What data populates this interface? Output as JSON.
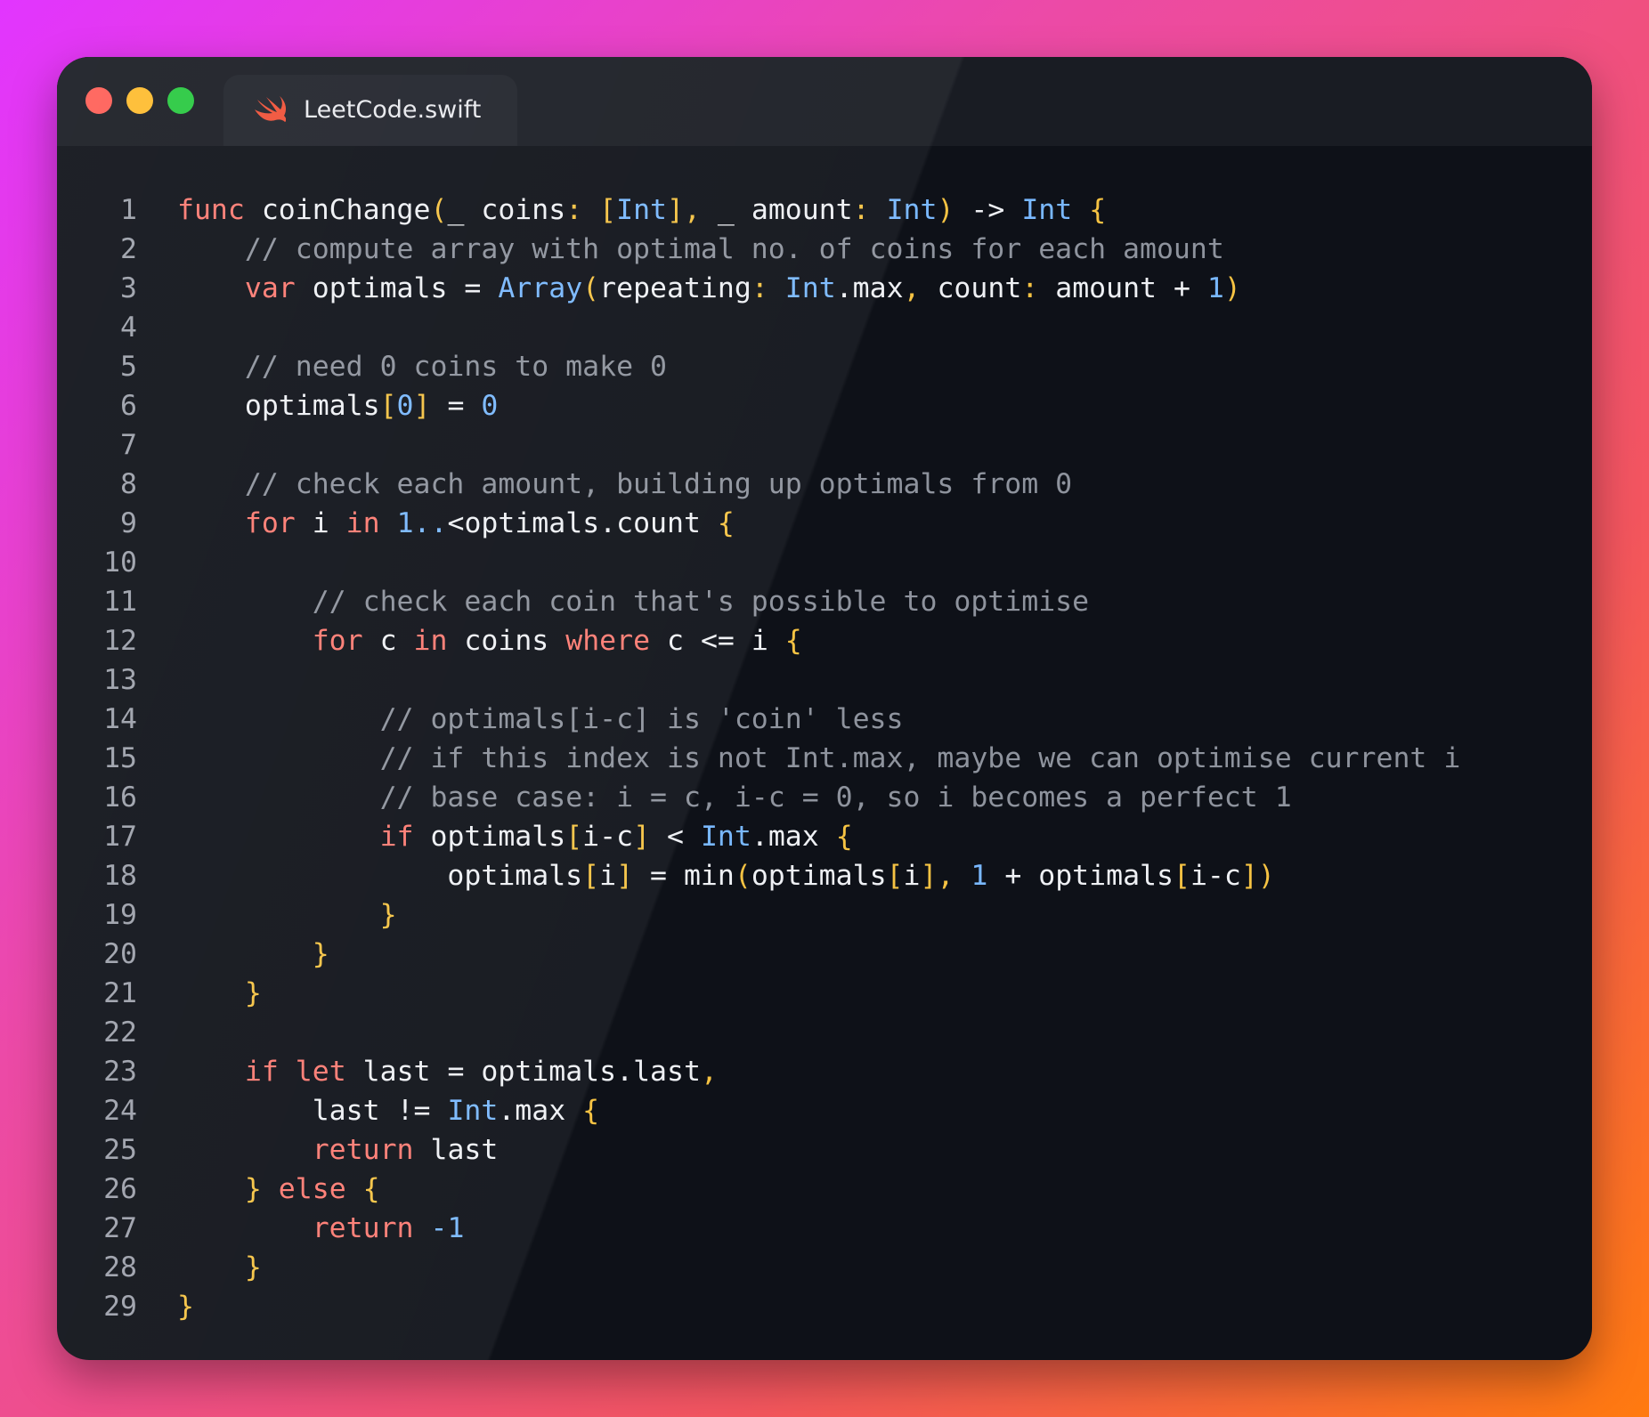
{
  "window": {
    "tab": {
      "filename": "LeetCode.swift",
      "icon": "swift-icon"
    }
  },
  "colors": {
    "keyword": "#ff7b72",
    "type": "#79b8ff",
    "bracket": "#f6c343",
    "comment": "#8e939d",
    "plain": "#eef0f4"
  },
  "code": {
    "lines": [
      [
        [
          "kw",
          "func"
        ],
        [
          "pl",
          " coinChange"
        ],
        [
          "br",
          "("
        ],
        [
          "pl",
          "_ coins"
        ],
        [
          "br",
          ":"
        ],
        [
          "pl",
          " "
        ],
        [
          "br",
          "["
        ],
        [
          "ty",
          "Int"
        ],
        [
          "br",
          "],"
        ],
        [
          "pl",
          " _ amount"
        ],
        [
          "br",
          ":"
        ],
        [
          "pl",
          " "
        ],
        [
          "ty",
          "Int"
        ],
        [
          "br",
          ")"
        ],
        [
          "pl",
          " -> "
        ],
        [
          "ty",
          "Int"
        ],
        [
          "pl",
          " "
        ],
        [
          "br",
          "{"
        ]
      ],
      [
        [
          "pl",
          "    "
        ],
        [
          "cm",
          "// compute array with optimal no. of coins for each amount"
        ]
      ],
      [
        [
          "pl",
          "    "
        ],
        [
          "kw",
          "var"
        ],
        [
          "pl",
          " optimals = "
        ],
        [
          "ty",
          "Array"
        ],
        [
          "br",
          "("
        ],
        [
          "pl",
          "repeating"
        ],
        [
          "br",
          ":"
        ],
        [
          "pl",
          " "
        ],
        [
          "ty",
          "Int"
        ],
        [
          "pl",
          ".max"
        ],
        [
          "br",
          ","
        ],
        [
          "pl",
          " count"
        ],
        [
          "br",
          ":"
        ],
        [
          "pl",
          " amount + "
        ],
        [
          "nm",
          "1"
        ],
        [
          "br",
          ")"
        ]
      ],
      [],
      [
        [
          "pl",
          "    "
        ],
        [
          "cm",
          "// need 0 coins to make 0"
        ]
      ],
      [
        [
          "pl",
          "    optimals"
        ],
        [
          "br",
          "["
        ],
        [
          "nm",
          "0"
        ],
        [
          "br",
          "]"
        ],
        [
          "pl",
          " = "
        ],
        [
          "nm",
          "0"
        ]
      ],
      [],
      [
        [
          "pl",
          "    "
        ],
        [
          "cm",
          "// check each amount, building up optimals from 0"
        ]
      ],
      [
        [
          "pl",
          "    "
        ],
        [
          "kw",
          "for"
        ],
        [
          "pl",
          " i "
        ],
        [
          "kw",
          "in"
        ],
        [
          "pl",
          " "
        ],
        [
          "nm",
          "1.."
        ],
        [
          "pl",
          "<optimals.count "
        ],
        [
          "br",
          "{"
        ]
      ],
      [],
      [
        [
          "pl",
          "        "
        ],
        [
          "cm",
          "// check each coin that's possible to optimise"
        ]
      ],
      [
        [
          "pl",
          "        "
        ],
        [
          "kw",
          "for"
        ],
        [
          "pl",
          " c "
        ],
        [
          "kw",
          "in"
        ],
        [
          "pl",
          " coins "
        ],
        [
          "kw",
          "where"
        ],
        [
          "pl",
          " c <= i "
        ],
        [
          "br",
          "{"
        ]
      ],
      [],
      [
        [
          "pl",
          "            "
        ],
        [
          "cm",
          "// optimals[i-c] is 'coin' less"
        ]
      ],
      [
        [
          "pl",
          "            "
        ],
        [
          "cm",
          "// if this index is not Int.max, maybe we can optimise current i"
        ]
      ],
      [
        [
          "pl",
          "            "
        ],
        [
          "cm",
          "// base case: i = c, i-c = 0, so i becomes a perfect 1"
        ]
      ],
      [
        [
          "pl",
          "            "
        ],
        [
          "kw",
          "if"
        ],
        [
          "pl",
          " optimals"
        ],
        [
          "br",
          "["
        ],
        [
          "pl",
          "i-c"
        ],
        [
          "br",
          "]"
        ],
        [
          "pl",
          " < "
        ],
        [
          "ty",
          "Int"
        ],
        [
          "pl",
          ".max "
        ],
        [
          "br",
          "{"
        ]
      ],
      [
        [
          "pl",
          "                optimals"
        ],
        [
          "br",
          "["
        ],
        [
          "pl",
          "i"
        ],
        [
          "br",
          "]"
        ],
        [
          "pl",
          " = min"
        ],
        [
          "br",
          "("
        ],
        [
          "pl",
          "optimals"
        ],
        [
          "br",
          "["
        ],
        [
          "pl",
          "i"
        ],
        [
          "br",
          "],"
        ],
        [
          "pl",
          " "
        ],
        [
          "nm",
          "1"
        ],
        [
          "pl",
          " + optimals"
        ],
        [
          "br",
          "["
        ],
        [
          "pl",
          "i-c"
        ],
        [
          "br",
          "])"
        ]
      ],
      [
        [
          "pl",
          "            "
        ],
        [
          "br",
          "}"
        ]
      ],
      [
        [
          "pl",
          "        "
        ],
        [
          "br",
          "}"
        ]
      ],
      [
        [
          "pl",
          "    "
        ],
        [
          "br",
          "}"
        ]
      ],
      [],
      [
        [
          "pl",
          "    "
        ],
        [
          "kw",
          "if"
        ],
        [
          "pl",
          " "
        ],
        [
          "kw",
          "let"
        ],
        [
          "pl",
          " last = optimals.last"
        ],
        [
          "br",
          ","
        ]
      ],
      [
        [
          "pl",
          "        last != "
        ],
        [
          "ty",
          "Int"
        ],
        [
          "pl",
          ".max "
        ],
        [
          "br",
          "{"
        ]
      ],
      [
        [
          "pl",
          "        "
        ],
        [
          "kw",
          "return"
        ],
        [
          "pl",
          " last"
        ]
      ],
      [
        [
          "pl",
          "    "
        ],
        [
          "br",
          "}"
        ],
        [
          "pl",
          " "
        ],
        [
          "kw",
          "else"
        ],
        [
          "pl",
          " "
        ],
        [
          "br",
          "{"
        ]
      ],
      [
        [
          "pl",
          "        "
        ],
        [
          "kw",
          "return"
        ],
        [
          "pl",
          " "
        ],
        [
          "nm",
          "-1"
        ]
      ],
      [
        [
          "pl",
          "    "
        ],
        [
          "br",
          "}"
        ]
      ],
      [
        [
          "br",
          "}"
        ]
      ]
    ]
  }
}
